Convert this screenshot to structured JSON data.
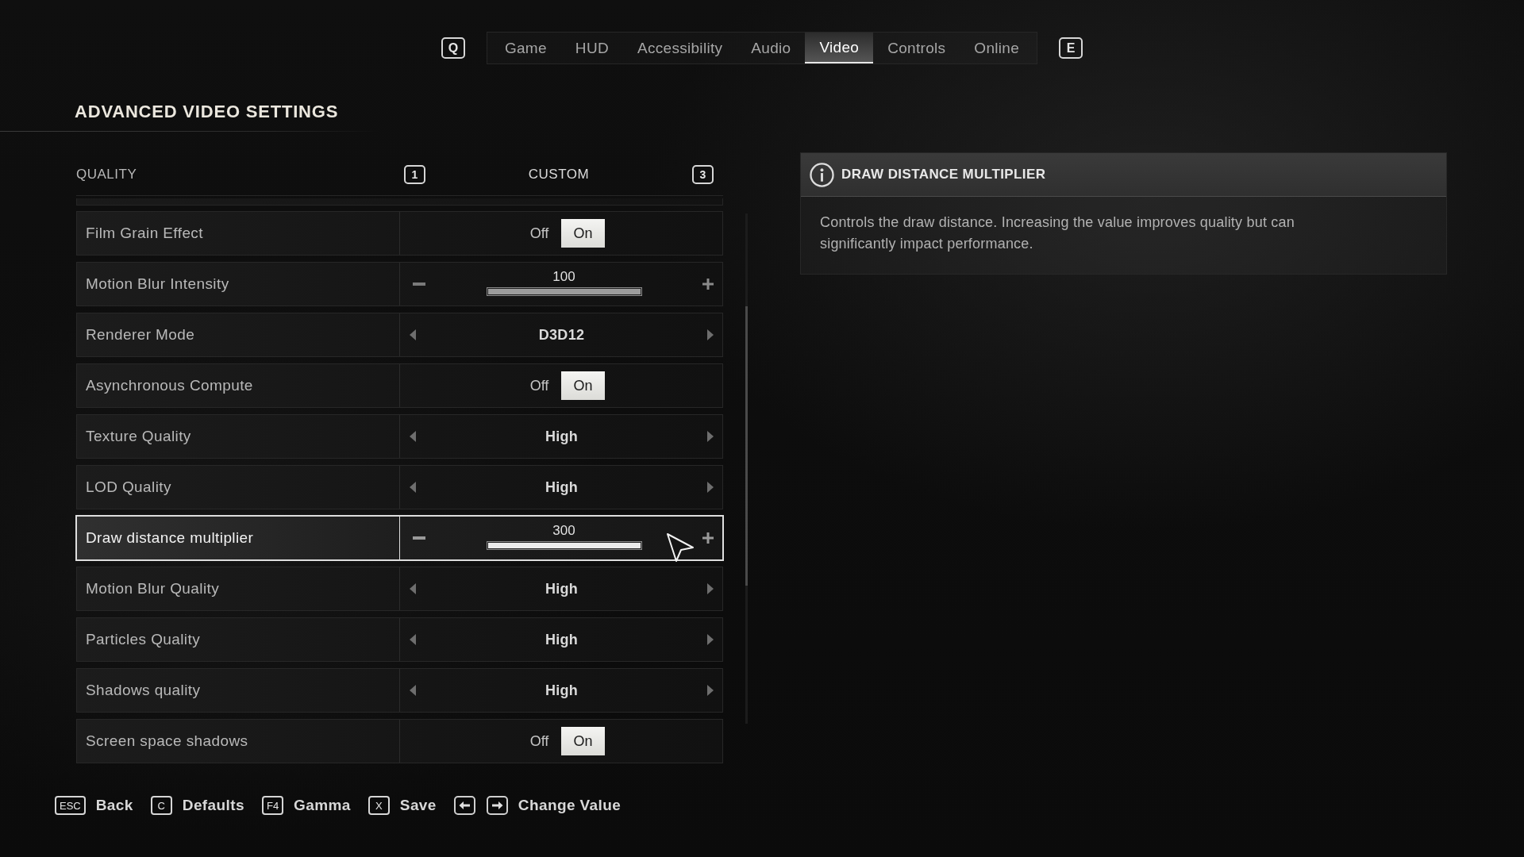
{
  "tabs": {
    "prev_key": "Q",
    "items": [
      {
        "label": "Game",
        "selected": false
      },
      {
        "label": "HUD",
        "selected": false
      },
      {
        "label": "Accessibility",
        "selected": false
      },
      {
        "label": "Audio",
        "selected": false
      },
      {
        "label": "Video",
        "selected": true
      },
      {
        "label": "Controls",
        "selected": false
      },
      {
        "label": "Online",
        "selected": false
      }
    ],
    "next_key": "E"
  },
  "title": "ADVANCED VIDEO SETTINGS",
  "quality": {
    "label": "QUALITY",
    "prev_key": "1",
    "value": "CUSTOM",
    "next_key": "3"
  },
  "settings": [
    {
      "label": "Film Grain Effect",
      "kind": "toggle",
      "off_label": "Off",
      "on_label": "On",
      "on": true,
      "selected": false
    },
    {
      "label": "Motion Blur Intensity",
      "kind": "slider",
      "value": "100",
      "level": 1,
      "selected": false
    },
    {
      "label": "Renderer Mode",
      "kind": "selector",
      "value": "D3D12",
      "selected": false
    },
    {
      "label": "Asynchronous Compute",
      "kind": "toggle",
      "off_label": "Off",
      "on_label": "On",
      "on": true,
      "selected": false
    },
    {
      "label": "Texture Quality",
      "kind": "selector",
      "value": "High",
      "selected": false
    },
    {
      "label": "LOD Quality",
      "kind": "selector",
      "value": "High",
      "selected": false
    },
    {
      "label": "Draw distance multiplier",
      "kind": "slider",
      "value": "300",
      "level": 1,
      "selected": true
    },
    {
      "label": "Motion Blur Quality",
      "kind": "selector",
      "value": "High",
      "selected": false
    },
    {
      "label": "Particles Quality",
      "kind": "selector",
      "value": "High",
      "selected": false
    },
    {
      "label": "Shadows quality",
      "kind": "selector",
      "value": "High",
      "selected": false
    },
    {
      "label": "Screen space shadows",
      "kind": "toggle",
      "off_label": "Off",
      "on_label": "On",
      "on": true,
      "selected": false
    }
  ],
  "info_panel": {
    "title": "DRAW DISTANCE MULTIPLIER",
    "text": "Controls the draw distance. Increasing the value improves quality but can significantly impact performance."
  },
  "footer": [
    {
      "kind": "key",
      "key": "ESC",
      "label": "Back"
    },
    {
      "kind": "key",
      "key": "C",
      "label": "Defaults"
    },
    {
      "kind": "key",
      "key": "F4",
      "label": "Gamma"
    },
    {
      "kind": "key",
      "key": "X",
      "label": "Save"
    },
    {
      "kind": "arrow_keys",
      "label": "Change Value"
    }
  ]
}
